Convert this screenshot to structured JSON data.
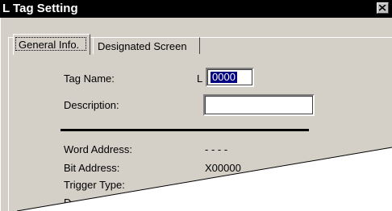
{
  "window": {
    "title": "L Tag Setting"
  },
  "tabs": [
    {
      "label": "General Info."
    },
    {
      "label": "Designated Screen"
    }
  ],
  "form": {
    "tag_name_label": "Tag Name:",
    "tag_prefix": "L",
    "tag_name_value": "0000",
    "description_label": "Description:",
    "description_value": "",
    "word_address_label": "Word Address:",
    "word_address_value": "- - - -",
    "bit_address_label": "Bit Address:",
    "bit_address_value": "X00000",
    "trigger_type_label": "Trigger Type:"
  },
  "icons": {
    "close": "close-icon"
  }
}
